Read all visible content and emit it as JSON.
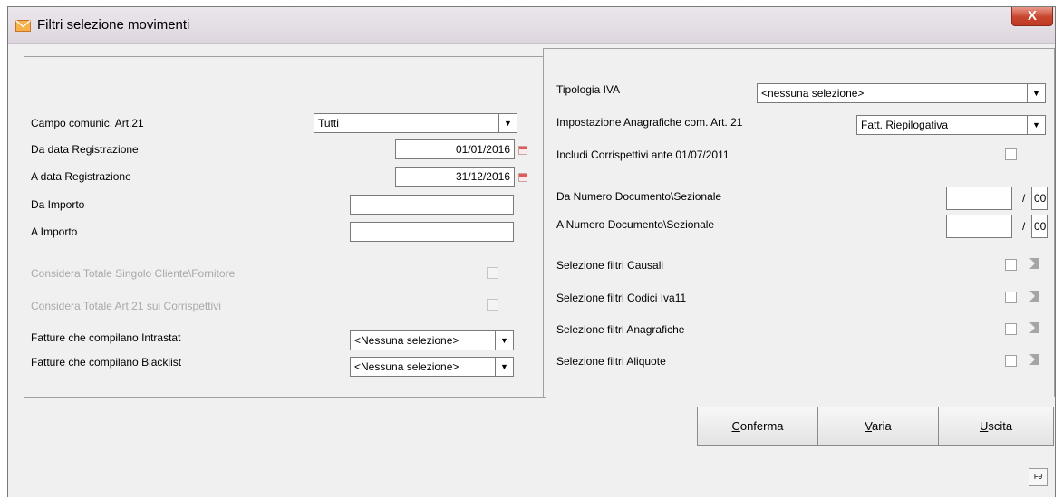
{
  "window": {
    "title": "Filtri selezione movimenti",
    "close": "X"
  },
  "left": {
    "campo_label": "Campo comunic. Art.21",
    "campo_value": "Tutti",
    "da_data_label": "Da data Registrazione",
    "da_data_value": "01/01/2016",
    "a_data_label": "A data Registrazione",
    "a_data_value": "31/12/2016",
    "da_importo_label": "Da Importo",
    "da_importo_value": "",
    "a_importo_label": "A Importo",
    "a_importo_value": "",
    "considera_singolo_label": "Considera Totale Singolo Cliente\\Fornitore",
    "considera_corrispettivi_label": "Considera Totale Art.21 sui Corrispettivi",
    "intrastat_label": "Fatture che compilano Intrastat",
    "intrastat_value": "<Nessuna selezione>",
    "blacklist_label": "Fatture che compilano Blacklist",
    "blacklist_value": "<Nessuna selezione>"
  },
  "right": {
    "tipologia_label": "Tipologia IVA",
    "tipologia_value": "<nessuna selezione>",
    "impostazione_label": "Impostazione Anagrafiche com. Art. 21",
    "impostazione_value": "Fatt. Riepilogativa",
    "includi_label": "Includi Corrispettivi ante 01/07/2011",
    "da_numero_label": "Da Numero Documento\\Sezionale",
    "da_numero_value": "",
    "da_sezionale_value": "00",
    "a_numero_label": "A Numero Documento\\Sezionale",
    "a_numero_value": "",
    "a_sezionale_value": "00",
    "slash": "/",
    "causali_label": "Selezione filtri Causali",
    "codici_label": "Selezione filtri Codici Iva11",
    "anagrafiche_label": "Selezione filtri Anagrafiche",
    "aliquote_label": "Selezione filtri Aliquote"
  },
  "buttons": {
    "conferma_key": "C",
    "conferma_rest": "onferma",
    "varia_key": "V",
    "varia_rest": "aria",
    "uscita_key": "U",
    "uscita_rest": "scita"
  },
  "status": {
    "f9": "F9"
  },
  "colors": {
    "close_button": "#c8452e",
    "window_bg": "#f0f0f0"
  },
  "icons": {
    "app": "mail-envelope-icon",
    "calendar": "calendar-icon",
    "filter": "filter-arrow-icon"
  }
}
